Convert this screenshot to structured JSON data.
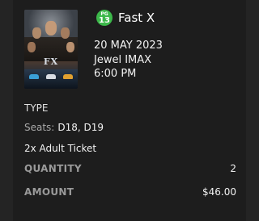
{
  "movie": {
    "title": "Fast X",
    "rating_top": "PG",
    "rating_num": "13",
    "rating_color": "#3cb84a",
    "poster_text": "FX"
  },
  "session": {
    "date": "20 MAY 2023",
    "venue": "Jewel IMAX",
    "time": "6:00 PM"
  },
  "details": {
    "type_label": "TYPE",
    "seats_label": "Seats:",
    "seats_value": "D18, D19",
    "ticket": "2x Adult Ticket"
  },
  "summary": {
    "quantity_label": "QUANTITY",
    "quantity_value": "2",
    "amount_label": "AMOUNT",
    "amount_value": "$46.00"
  }
}
